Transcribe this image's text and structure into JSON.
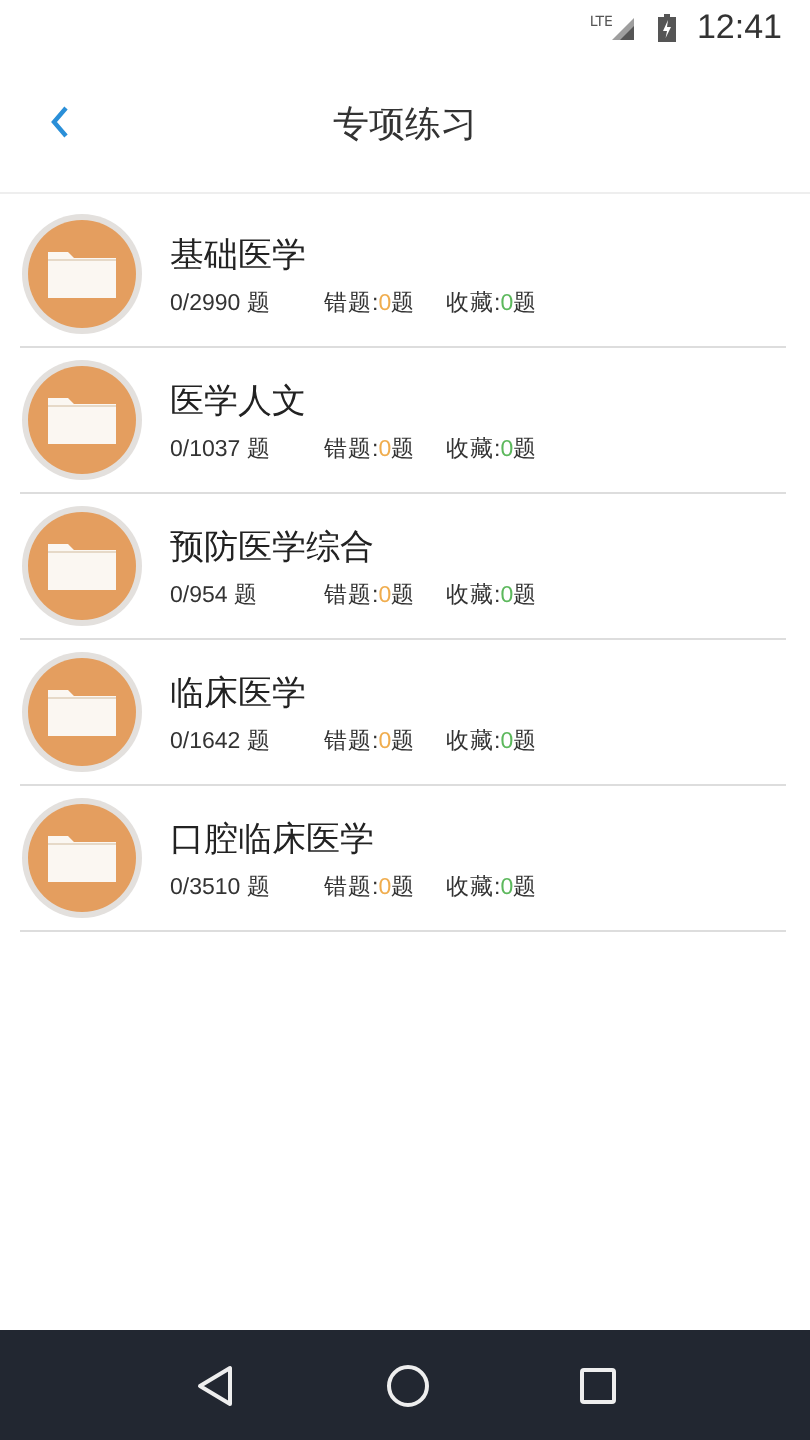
{
  "status_bar": {
    "network": "LTE",
    "time": "12:41"
  },
  "header": {
    "title": "专项练习"
  },
  "items": [
    {
      "title": "基础医学",
      "progress": "0/2990 题",
      "wrong_label": "错题:",
      "wrong": "0",
      "wrong_unit": "题",
      "fav_label": "收藏:",
      "fav": "0",
      "fav_unit": "题"
    },
    {
      "title": "医学人文",
      "progress": "0/1037 题",
      "wrong_label": "错题:",
      "wrong": "0",
      "wrong_unit": "题",
      "fav_label": "收藏:",
      "fav": "0",
      "fav_unit": "题"
    },
    {
      "title": "预防医学综合",
      "progress": "0/954 题",
      "wrong_label": "错题:",
      "wrong": "0",
      "wrong_unit": "题",
      "fav_label": "收藏:",
      "fav": "0",
      "fav_unit": "题"
    },
    {
      "title": "临床医学",
      "progress": "0/1642 题",
      "wrong_label": "错题:",
      "wrong": "0",
      "wrong_unit": "题",
      "fav_label": "收藏:",
      "fav": "0",
      "fav_unit": "题"
    },
    {
      "title": "口腔临床医学",
      "progress": "0/3510 题",
      "wrong_label": "错题:",
      "wrong": "0",
      "wrong_unit": "题",
      "fav_label": "收藏:",
      "fav": "0",
      "fav_unit": "题"
    }
  ]
}
